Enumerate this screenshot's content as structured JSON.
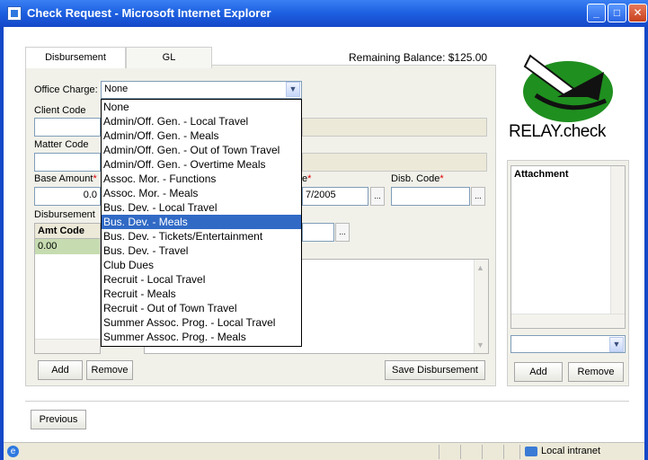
{
  "window": {
    "title": "Check Request - Microsoft Internet Explorer",
    "minimize": "_",
    "maximize": "□",
    "close": "✕"
  },
  "tabs": [
    {
      "label": "Disbursement"
    },
    {
      "label": "GL"
    }
  ],
  "remaining_balance": "Remaining Balance: $125.00",
  "form": {
    "office_charge_label": "Office Charge:",
    "office_charge_value": "None",
    "client_code_label": "Client Code",
    "matter_code_label": "Matter Code",
    "base_amount_label": "Base Amount",
    "base_amount_value": "0.0",
    "date_label_partial": "e",
    "date_value_partial": "7/2005",
    "disb_code_label": "Disb. Code",
    "required_mark": "*",
    "disbursements_label": "Disbursement",
    "grid_header": "Amt Code",
    "grid_value": "0.00",
    "dots": "..."
  },
  "dropdown_options": [
    "None",
    "Admin/Off. Gen. - Local Travel",
    "Admin/Off. Gen. - Meals",
    "Admin/Off. Gen. - Out of Town Travel",
    "Admin/Off. Gen. - Overtime Meals",
    "Assoc. Mor. - Functions",
    "Assoc. Mor. - Meals",
    "Bus. Dev. - Local Travel",
    "Bus. Dev. - Meals",
    "Bus. Dev. - Tickets/Entertainment",
    "Bus. Dev. - Travel",
    "Club Dues",
    "Recruit - Local Travel",
    "Recruit - Meals",
    "Recruit - Out of Town Travel",
    "Summer Assoc. Prog. - Local Travel",
    "Summer Assoc. Prog. - Meals"
  ],
  "selected_option": "Bus. Dev. - Meals",
  "buttons": {
    "add": "Add",
    "remove": "Remove",
    "save_disbursement": "Save Disbursement",
    "previous": "Previous",
    "attach_add": "Add",
    "attach_remove": "Remove"
  },
  "logo": {
    "text": "RELAY.check"
  },
  "attachment": {
    "header": "Attachment"
  },
  "statusbar": {
    "zone": "Local intranet"
  },
  "colors": {
    "titlebar": "#1c5fe0",
    "selection": "#316ac5",
    "logo_green": "#1f8f1f"
  }
}
